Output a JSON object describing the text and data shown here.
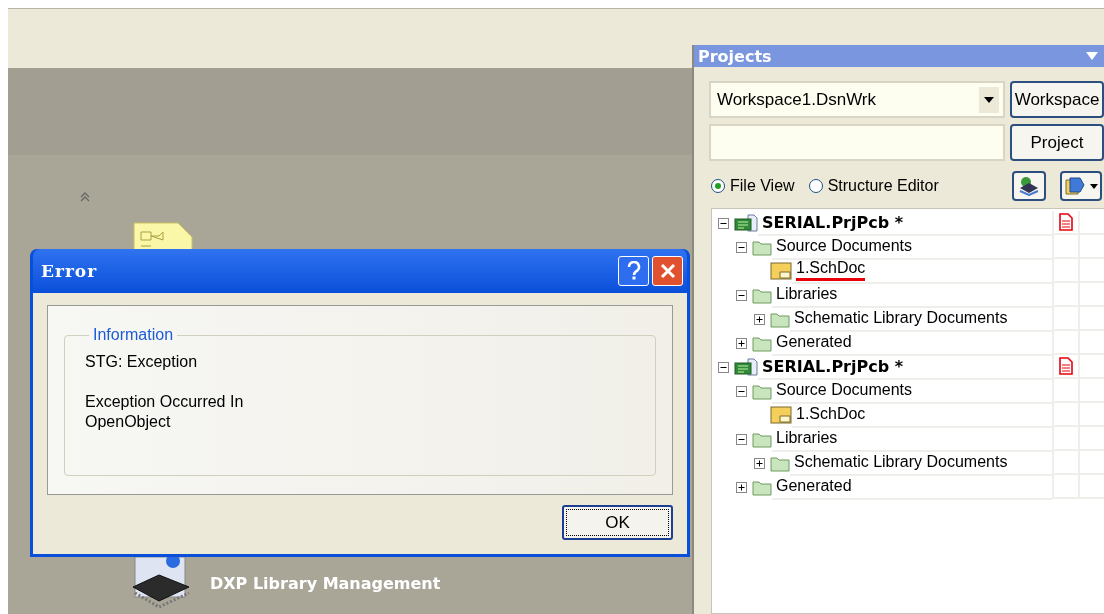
{
  "projects_panel": {
    "title": "Projects",
    "workspace_combo": {
      "value": "Workspace1.DsnWrk"
    },
    "buttons": [
      "Workspace",
      "Project"
    ],
    "view_options": [
      {
        "label": "File View",
        "selected": true
      },
      {
        "label": "Structure Editor",
        "selected": false
      }
    ],
    "tree": [
      {
        "label": "SERIAL.PrjPcb *",
        "kind": "project",
        "expanded": true,
        "modified": true,
        "marked": false,
        "children": [
          {
            "label": "Source Documents",
            "kind": "folder",
            "expanded": true,
            "marked": false,
            "children": [
              {
                "label": "1.SchDoc",
                "kind": "document",
                "marked": true
              }
            ]
          },
          {
            "label": "Libraries",
            "kind": "folder",
            "expanded": true,
            "marked": false,
            "children": [
              {
                "label": "Schematic Library Documents",
                "kind": "folder",
                "expanded": false,
                "marked": false
              }
            ]
          },
          {
            "label": "Generated",
            "kind": "folder",
            "expanded": false,
            "marked": false
          }
        ]
      },
      {
        "label": "SERIAL.PrjPcb *",
        "kind": "project",
        "expanded": true,
        "modified": true,
        "marked": false,
        "children": [
          {
            "label": "Source Documents",
            "kind": "folder",
            "expanded": true,
            "marked": false,
            "children": [
              {
                "label": "1.SchDoc",
                "kind": "document",
                "marked": false
              }
            ]
          },
          {
            "label": "Libraries",
            "kind": "folder",
            "expanded": true,
            "marked": false,
            "children": [
              {
                "label": "Schematic Library Documents",
                "kind": "folder",
                "expanded": false,
                "marked": false
              }
            ]
          },
          {
            "label": "Generated",
            "kind": "folder",
            "expanded": false,
            "marked": false
          }
        ]
      }
    ]
  },
  "library_item": {
    "label": "DXP Library Management"
  },
  "error_dialog": {
    "title": "Error",
    "group_label": "Information",
    "paragraphs": [
      "STG: Exception",
      "Exception Occurred In\nOpenObject"
    ],
    "button": "OK"
  }
}
